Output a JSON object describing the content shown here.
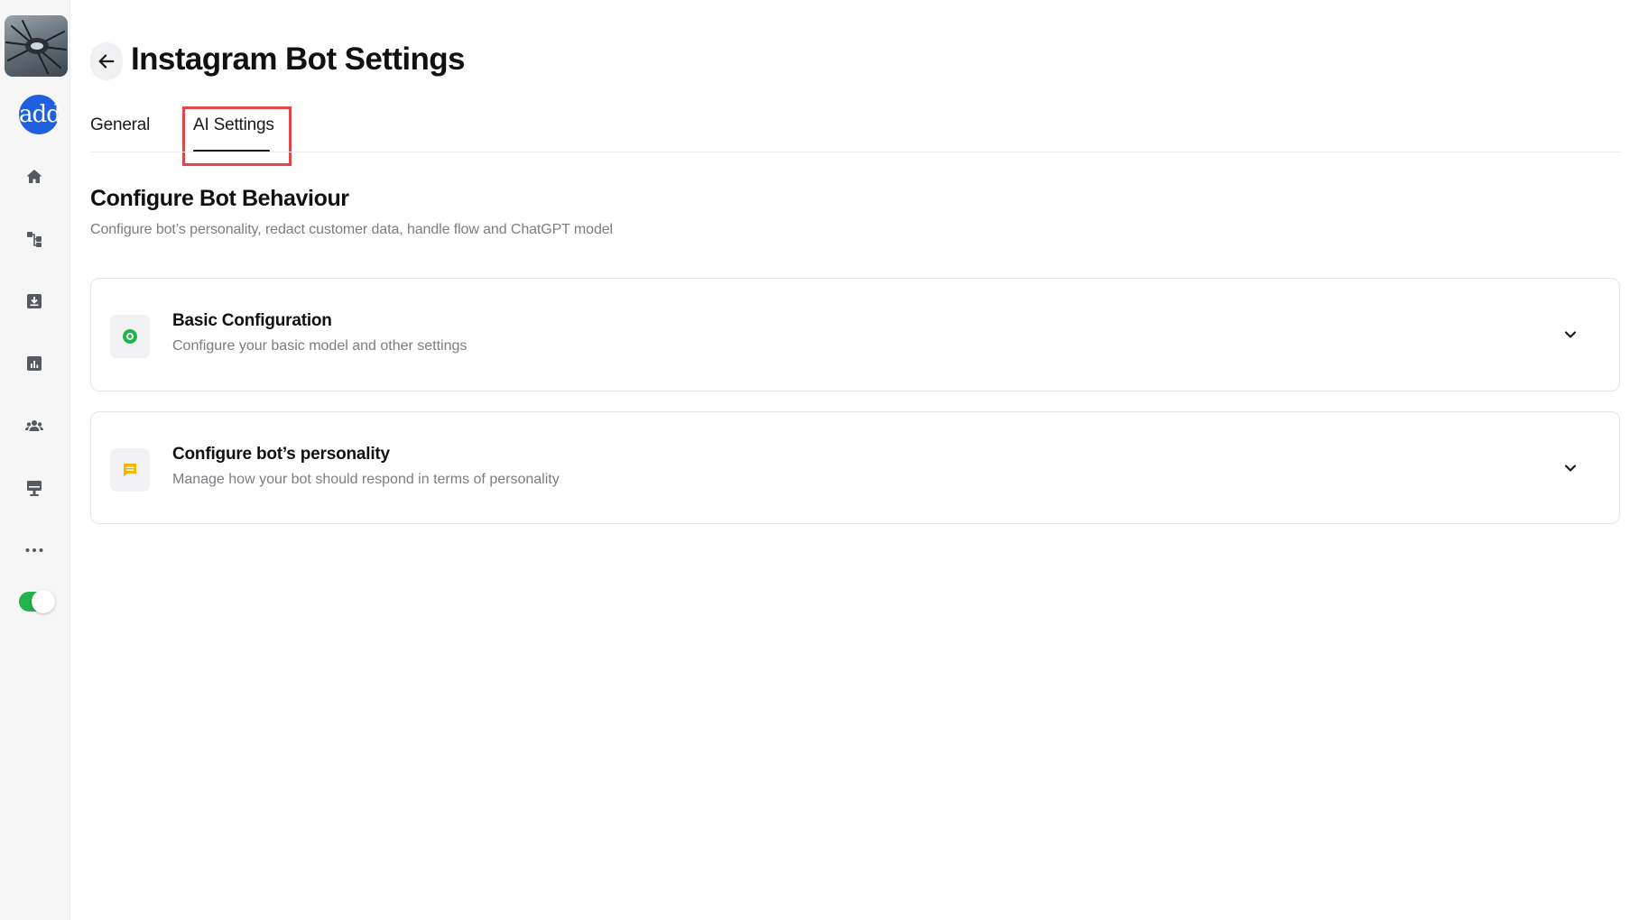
{
  "header": {
    "title": "Instagram Bot Settings"
  },
  "sidebar": {
    "avatar_text": "add",
    "items": [
      {
        "icon": "home-icon"
      },
      {
        "icon": "flows-icon"
      },
      {
        "icon": "inbox-download-icon"
      },
      {
        "icon": "analytics-icon"
      },
      {
        "icon": "contacts-icon"
      },
      {
        "icon": "kiosk-icon"
      },
      {
        "icon": "more-icon"
      }
    ],
    "toggle_on": true
  },
  "tabs": [
    {
      "label": "General",
      "active": false
    },
    {
      "label": "AI Settings",
      "active": true
    }
  ],
  "section": {
    "title": "Configure Bot Behaviour",
    "description": "Configure bot’s personality, redact customer data, handle flow and ChatGPT model"
  },
  "cards": [
    {
      "icon": "basic-config-icon",
      "title": "Basic Configuration",
      "description": "Configure your basic model and other settings"
    },
    {
      "icon": "chat-icon",
      "title": "Configure bot’s personality",
      "description": "Manage how your bot should respond in terms of personality"
    }
  ],
  "colors": {
    "accent_blue": "#1f5fe0",
    "toggle_green": "#22b34a",
    "highlight_red": "#e0464a",
    "config_icon_green": "#22b34a",
    "chat_icon_yellow": "#f2b705"
  }
}
